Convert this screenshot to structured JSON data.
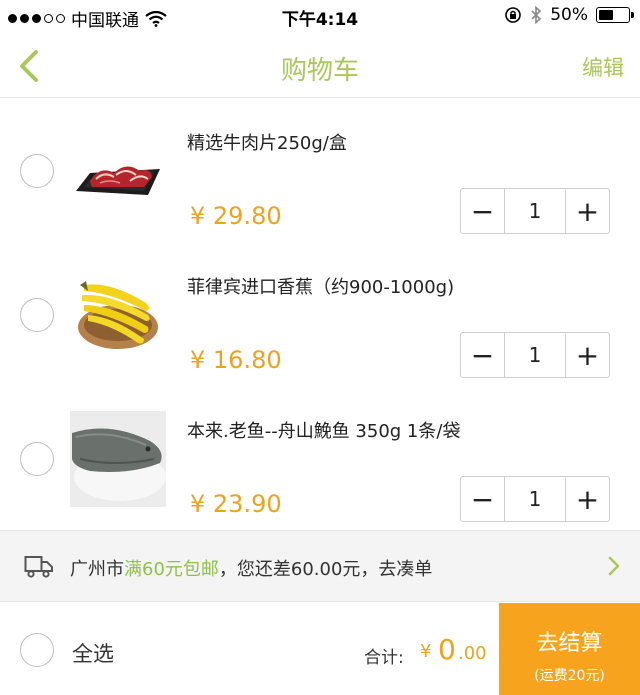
{
  "status_bar": {
    "carrier": "中国联通",
    "time": "下午4:14",
    "battery": "50%",
    "battery_level": 0.5
  },
  "nav": {
    "title": "购物车",
    "edit": "编辑",
    "back_icon": "chevron-left-icon"
  },
  "items": [
    {
      "name": "精选牛肉片250g/盒",
      "price": "¥ 29.80",
      "quantity": "1",
      "image_icon": "beef-slices-image"
    },
    {
      "name": "菲律宾进口香蕉（约900-1000g)",
      "price": "¥ 16.80",
      "quantity": "1",
      "image_icon": "bananas-image"
    },
    {
      "name": "本来.老鱼--舟山鮸鱼 350g 1条/袋",
      "price": "¥ 23.90",
      "quantity": "1",
      "image_icon": "fish-image"
    }
  ],
  "stepper": {
    "minus": "−",
    "plus": "+"
  },
  "shipping": {
    "city": "广州市",
    "promo": "满60元包邮",
    "rest": "，您还差60.00元，去凑单",
    "icon": "truck-icon"
  },
  "footer": {
    "select_all": "全选",
    "total_label": "合计:",
    "currency": "¥",
    "total_int": "0",
    "total_dec": ".00",
    "checkout": "去结算",
    "freight": "(运费20元)"
  },
  "colors": {
    "accent_green": "#a8c957",
    "price_orange": "#f0a21a",
    "checkout_orange": "#f7a31d"
  }
}
